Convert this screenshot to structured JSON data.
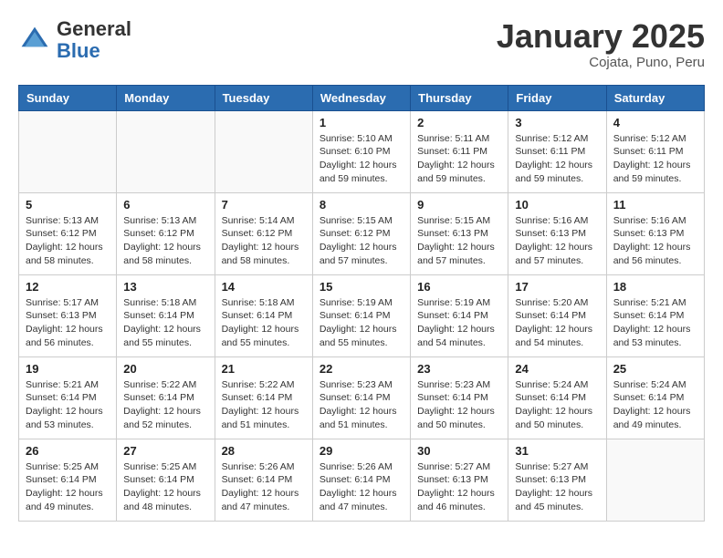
{
  "header": {
    "logo_general": "General",
    "logo_blue": "Blue",
    "month_title": "January 2025",
    "location": "Cojata, Puno, Peru"
  },
  "weekdays": [
    "Sunday",
    "Monday",
    "Tuesday",
    "Wednesday",
    "Thursday",
    "Friday",
    "Saturday"
  ],
  "weeks": [
    [
      {
        "day": "",
        "info": ""
      },
      {
        "day": "",
        "info": ""
      },
      {
        "day": "",
        "info": ""
      },
      {
        "day": "1",
        "info": "Sunrise: 5:10 AM\nSunset: 6:10 PM\nDaylight: 12 hours\nand 59 minutes."
      },
      {
        "day": "2",
        "info": "Sunrise: 5:11 AM\nSunset: 6:11 PM\nDaylight: 12 hours\nand 59 minutes."
      },
      {
        "day": "3",
        "info": "Sunrise: 5:12 AM\nSunset: 6:11 PM\nDaylight: 12 hours\nand 59 minutes."
      },
      {
        "day": "4",
        "info": "Sunrise: 5:12 AM\nSunset: 6:11 PM\nDaylight: 12 hours\nand 59 minutes."
      }
    ],
    [
      {
        "day": "5",
        "info": "Sunrise: 5:13 AM\nSunset: 6:12 PM\nDaylight: 12 hours\nand 58 minutes."
      },
      {
        "day": "6",
        "info": "Sunrise: 5:13 AM\nSunset: 6:12 PM\nDaylight: 12 hours\nand 58 minutes."
      },
      {
        "day": "7",
        "info": "Sunrise: 5:14 AM\nSunset: 6:12 PM\nDaylight: 12 hours\nand 58 minutes."
      },
      {
        "day": "8",
        "info": "Sunrise: 5:15 AM\nSunset: 6:12 PM\nDaylight: 12 hours\nand 57 minutes."
      },
      {
        "day": "9",
        "info": "Sunrise: 5:15 AM\nSunset: 6:13 PM\nDaylight: 12 hours\nand 57 minutes."
      },
      {
        "day": "10",
        "info": "Sunrise: 5:16 AM\nSunset: 6:13 PM\nDaylight: 12 hours\nand 57 minutes."
      },
      {
        "day": "11",
        "info": "Sunrise: 5:16 AM\nSunset: 6:13 PM\nDaylight: 12 hours\nand 56 minutes."
      }
    ],
    [
      {
        "day": "12",
        "info": "Sunrise: 5:17 AM\nSunset: 6:13 PM\nDaylight: 12 hours\nand 56 minutes."
      },
      {
        "day": "13",
        "info": "Sunrise: 5:18 AM\nSunset: 6:14 PM\nDaylight: 12 hours\nand 55 minutes."
      },
      {
        "day": "14",
        "info": "Sunrise: 5:18 AM\nSunset: 6:14 PM\nDaylight: 12 hours\nand 55 minutes."
      },
      {
        "day": "15",
        "info": "Sunrise: 5:19 AM\nSunset: 6:14 PM\nDaylight: 12 hours\nand 55 minutes."
      },
      {
        "day": "16",
        "info": "Sunrise: 5:19 AM\nSunset: 6:14 PM\nDaylight: 12 hours\nand 54 minutes."
      },
      {
        "day": "17",
        "info": "Sunrise: 5:20 AM\nSunset: 6:14 PM\nDaylight: 12 hours\nand 54 minutes."
      },
      {
        "day": "18",
        "info": "Sunrise: 5:21 AM\nSunset: 6:14 PM\nDaylight: 12 hours\nand 53 minutes."
      }
    ],
    [
      {
        "day": "19",
        "info": "Sunrise: 5:21 AM\nSunset: 6:14 PM\nDaylight: 12 hours\nand 53 minutes."
      },
      {
        "day": "20",
        "info": "Sunrise: 5:22 AM\nSunset: 6:14 PM\nDaylight: 12 hours\nand 52 minutes."
      },
      {
        "day": "21",
        "info": "Sunrise: 5:22 AM\nSunset: 6:14 PM\nDaylight: 12 hours\nand 51 minutes."
      },
      {
        "day": "22",
        "info": "Sunrise: 5:23 AM\nSunset: 6:14 PM\nDaylight: 12 hours\nand 51 minutes."
      },
      {
        "day": "23",
        "info": "Sunrise: 5:23 AM\nSunset: 6:14 PM\nDaylight: 12 hours\nand 50 minutes."
      },
      {
        "day": "24",
        "info": "Sunrise: 5:24 AM\nSunset: 6:14 PM\nDaylight: 12 hours\nand 50 minutes."
      },
      {
        "day": "25",
        "info": "Sunrise: 5:24 AM\nSunset: 6:14 PM\nDaylight: 12 hours\nand 49 minutes."
      }
    ],
    [
      {
        "day": "26",
        "info": "Sunrise: 5:25 AM\nSunset: 6:14 PM\nDaylight: 12 hours\nand 49 minutes."
      },
      {
        "day": "27",
        "info": "Sunrise: 5:25 AM\nSunset: 6:14 PM\nDaylight: 12 hours\nand 48 minutes."
      },
      {
        "day": "28",
        "info": "Sunrise: 5:26 AM\nSunset: 6:14 PM\nDaylight: 12 hours\nand 47 minutes."
      },
      {
        "day": "29",
        "info": "Sunrise: 5:26 AM\nSunset: 6:14 PM\nDaylight: 12 hours\nand 47 minutes."
      },
      {
        "day": "30",
        "info": "Sunrise: 5:27 AM\nSunset: 6:13 PM\nDaylight: 12 hours\nand 46 minutes."
      },
      {
        "day": "31",
        "info": "Sunrise: 5:27 AM\nSunset: 6:13 PM\nDaylight: 12 hours\nand 45 minutes."
      },
      {
        "day": "",
        "info": ""
      }
    ]
  ]
}
